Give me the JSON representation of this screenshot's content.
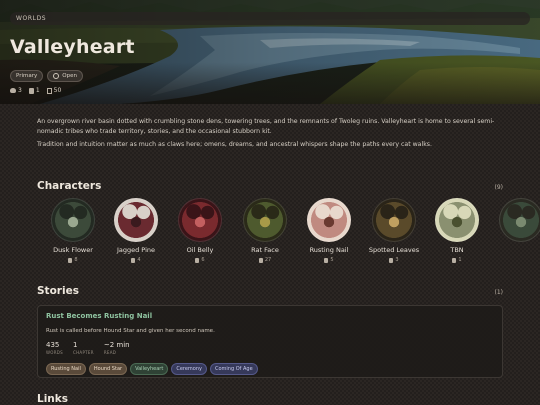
{
  "breadcrumb": "WORLDS",
  "world": {
    "title": "Valleyheart",
    "badges": [
      "Primary",
      "Open"
    ],
    "stats": {
      "members": "3",
      "books": "1",
      "docs": "50"
    },
    "description": [
      "An overgrown river basin dotted with crumbling stone dens, towering trees, and the remnants of Twoleg ruins. Valleyheart is home to several semi-nomadic tribes who trade territory, stories, and the occasional stubborn kit.",
      "Tradition and intuition matter as much as claws here; omens, dreams, and ancestral whispers shape the paths every cat walks."
    ]
  },
  "characters": {
    "title": "Characters",
    "count": "(9)",
    "items": [
      {
        "name": "Dusk Flower",
        "meta": "8",
        "palette": [
          "#3c4a3a",
          "#232a22",
          "#9aa890"
        ]
      },
      {
        "name": "Jagged Pine",
        "meta": "4",
        "palette": [
          "#6a2a30",
          "#d8d0c8",
          "#3a1a1e"
        ]
      },
      {
        "name": "Oil Belly",
        "meta": "6",
        "palette": [
          "#7a2a2e",
          "#3a1418",
          "#c46060"
        ]
      },
      {
        "name": "Rat Face",
        "meta": "27",
        "palette": [
          "#4e5a2e",
          "#2a2a18",
          "#a89a48"
        ]
      },
      {
        "name": "Rusting Nail",
        "meta": "5",
        "palette": [
          "#c08a80",
          "#e8d8cc",
          "#6a3a30"
        ]
      },
      {
        "name": "Spotted Leaves",
        "meta": "3",
        "palette": [
          "#5a4a2a",
          "#2a2418",
          "#c0a060"
        ]
      },
      {
        "name": "TBN",
        "meta": "1",
        "palette": [
          "#8a9070",
          "#d8d8b8",
          "#4a5030"
        ]
      },
      {
        "name": "",
        "meta": "",
        "palette": [
          "#3a4a3a",
          "#2a2a22",
          "#7a8a70"
        ]
      }
    ]
  },
  "stories": {
    "title": "Stories",
    "count": "(1)",
    "items": [
      {
        "title": "Rust Becomes Rusting Nail",
        "summary": "Rust is called before Hound Star and given her second name.",
        "words": "435",
        "words_label": "WORDS",
        "chapters": "1",
        "chapters_label": "CHAPTER",
        "read": "~2 min",
        "read_label": "READ",
        "tags": [
          "Rusting Nail",
          "Hound Star",
          "Valleyheart",
          "Ceremony",
          "Coming Of Age"
        ]
      }
    ]
  },
  "links": {
    "title": "Links"
  },
  "icons": [
    "globe-icon",
    "group-icon",
    "book-icon",
    "document-icon"
  ]
}
